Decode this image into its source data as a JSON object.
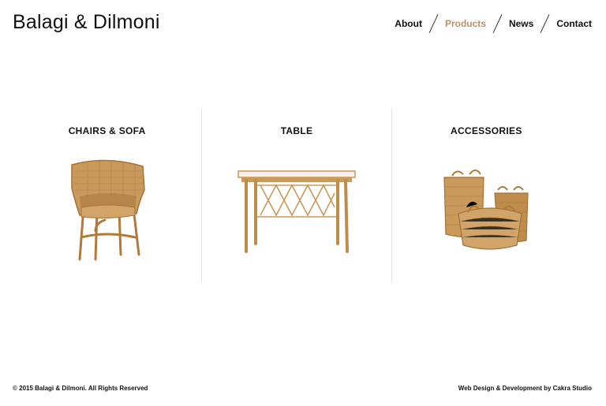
{
  "brand": {
    "name": "Balagi & Dilmoni"
  },
  "nav": {
    "items": [
      {
        "label": "About"
      },
      {
        "label": "Products",
        "active": true
      },
      {
        "label": "News"
      },
      {
        "label": "Contact"
      }
    ]
  },
  "categories": [
    {
      "title": "CHAIRS & SOFA",
      "image_icon": "wicker-chair"
    },
    {
      "title": "TABLE",
      "image_icon": "rattan-table"
    },
    {
      "title": "ACCESSORIES",
      "image_icon": "wicker-baskets"
    }
  ],
  "footer": {
    "copyright": "© 2015 Balagi & Dilmoni. All Rights Reserved",
    "credit": "Web Design & Development by Cakra Studio"
  },
  "colors": {
    "text": "#111111",
    "accent": "#b8936a",
    "rattan": "#c99a5b",
    "divider": "#e3e3e3"
  }
}
